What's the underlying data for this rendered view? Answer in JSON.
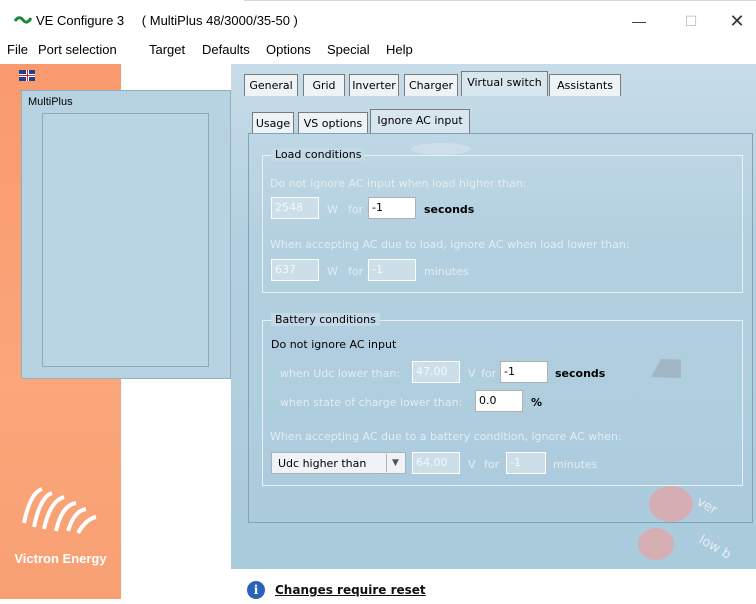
{
  "window": {
    "app_title": "VE Configure 3",
    "device_title": "( MultiPlus 48/3000/35-50 )",
    "minimize": "—",
    "maximize": "☐",
    "close": "✕"
  },
  "menu": [
    "File",
    "Port selection",
    "Target",
    "Defaults",
    "Options",
    "Special",
    "Help"
  ],
  "sidebar": {
    "device_name": "MultiPlus",
    "brand": "Victron Energy"
  },
  "tabs": [
    "General",
    "Grid",
    "Inverter",
    "Charger",
    "Virtual switch",
    "Assistants"
  ],
  "active_tab": "Virtual switch",
  "subtabs": [
    "Usage",
    "VS options",
    "Ignore AC input"
  ],
  "active_subtab": "Ignore AC input",
  "load_conditions": {
    "title": "Load conditions",
    "line1": "Do not ignore AC input when load higher than:",
    "watts1": "2548",
    "unit_w1": "W",
    "for1": "for",
    "time1": "-1",
    "seconds": "seconds",
    "line2": "When accepting AC due to load, ignore AC when load lower than:",
    "watts2": "637",
    "unit_w2": "W",
    "for2": "for",
    "time2": "-1",
    "minutes": "minutes"
  },
  "battery_conditions": {
    "title": "Battery conditions",
    "header": "Do not ignore AC input",
    "udc_label": "when Udc lower than:",
    "udc_value": "47.00",
    "unit_v": "V",
    "for_label": "for",
    "udc_time": "-1",
    "seconds": "seconds",
    "soc_label": "when state of charge lower than:",
    "soc_value": "0.0",
    "soc_unit": "%",
    "ignore_line": "When accepting AC due to a battery condition, ignore AC when:",
    "select_value": "Udc higher than",
    "select_arrow": "▼",
    "v_value": "64.00",
    "unit_v2": "V",
    "for_label2": "for",
    "time_value": "-1",
    "minutes": "minutes"
  },
  "status": {
    "info_symbol": "i",
    "message": "Changes require reset"
  },
  "colors": {
    "sidebar_orange": "#f99a6e",
    "panel_blue": "#b3d0e0",
    "info_blue": "#2a64b8"
  }
}
